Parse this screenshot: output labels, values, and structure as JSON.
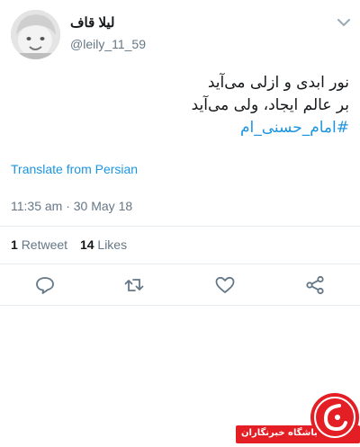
{
  "tweet": {
    "author": {
      "display_name": "لیلا قاف",
      "handle": "@leily_11_59"
    },
    "text_lines": [
      "نور ابدی و ازلی می‌آید",
      "بر عالم ایجاد، ولی می‌آید"
    ],
    "hashtag": "#امام_حسنی_ام",
    "translate_label": "Translate from Persian",
    "timestamp": "11:35 am · 30 May 18",
    "stats": {
      "retweets_count": "1",
      "retweets_label": "Retweet",
      "likes_count": "14",
      "likes_label": "Likes"
    },
    "icons": {
      "menu": "chevron-down-icon",
      "reply": "reply-icon",
      "retweet": "retweet-icon",
      "like": "heart-icon",
      "share": "share-icon"
    }
  },
  "watermark": {
    "text": "باشگاه خبرنگاران"
  },
  "colors": {
    "link": "#1b95e0",
    "secondary_text": "#657786",
    "divider": "#e6ecf0",
    "watermark_red": "#e31e24"
  }
}
